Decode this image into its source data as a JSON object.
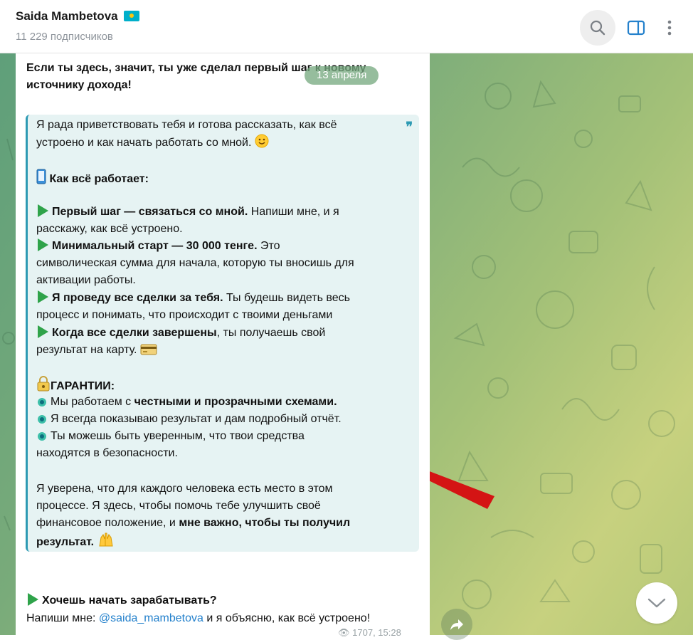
{
  "header": {
    "channel_name": "Saida Mambetova",
    "flag_icon": "kazakhstan-flag",
    "subscribers": "11 229 подписчиков",
    "icons": [
      "search-icon",
      "sidebar-toggle-icon",
      "more-vertical-icon"
    ]
  },
  "date_pill": "13 апреля",
  "message": {
    "intro": "Если ты здесь, значит, ты уже сделал первый шаг к новому источнику дохода!",
    "quote": {
      "greeting_1": "Я рада приветствовать тебя и готова рассказать, как всё",
      "greeting_2": "устроено и как начать работать со мной.",
      "how_title": "Как всё работает:",
      "step1_bold": "Первый шаг — связаться со мной.",
      "step1_rest": " Напиши мне, и я",
      "step1_line2": "расскажу, как всё устроено.",
      "step2_bold": "Минимальный старт — 30 000 тенге.",
      "step2_rest": " Это",
      "step2_line2": "символическая сумма для начала, которую ты вносишь для",
      "step2_line3": "активации работы.",
      "step3_bold": "Я проведу все сделки за тебя.",
      "step3_rest": " Ты будешь видеть весь",
      "step3_line2": "процесс и понимать, что происходит с твоими деньгами",
      "step4_bold": "Когда все сделки завершены",
      "step4_rest": ", ты получаешь свой",
      "step4_line2": "результат на карту.",
      "guarantee_title": "ГАРАНТИИ:",
      "g1_pre": "Мы работаем с ",
      "g1_bold": "честными и прозрачными схемами.",
      "g2": "Я всегда показываю результат и дам подробный отчёт.",
      "g3_line1": "Ты можешь быть уверенным, что твои средства",
      "g3_line2": "находятся в безопасности.",
      "closing_1": "Я уверена, что для каждого человека есть место в этом",
      "closing_2": "процессе. Я здесь, чтобы помочь тебе улучшить своё",
      "closing_3_pre": "финансовое положение, и ",
      "closing_3_bold": "мне важно, чтобы ты получил",
      "closing_4_bold": "результат."
    },
    "cta_title": "Хочешь начать зарабатывать?",
    "cta_pre": "Напиши мне: ",
    "cta_link": "@saida_mambetova",
    "cta_post": " и я объясню, как всё устроено!",
    "views": "1707",
    "time": "15:28"
  },
  "colors": {
    "accent": "#2481cc",
    "quote_bar": "#2d9ab3",
    "quote_bg": "#e6f3f3",
    "arrow": "#d41414"
  },
  "emoji": [
    "smile",
    "mobile-phone",
    "green-triangle",
    "credit-card",
    "lock-key",
    "blue-ring",
    "raising-hands"
  ]
}
